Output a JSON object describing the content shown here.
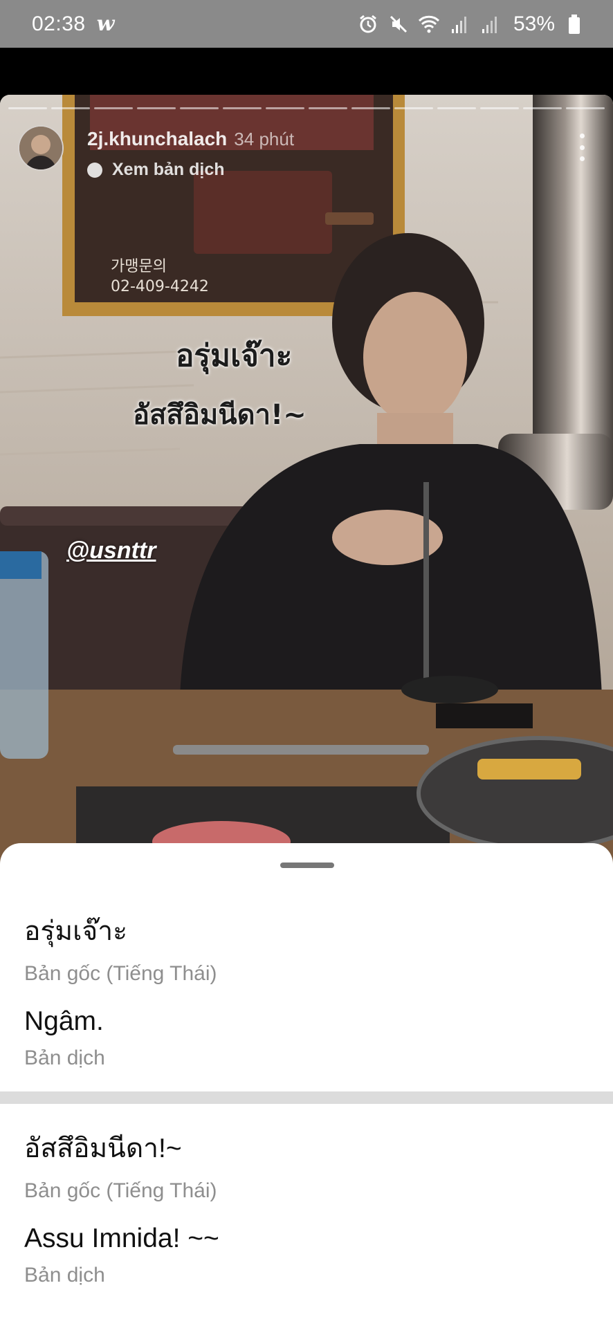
{
  "status_bar": {
    "time": "02:38",
    "app_glyph": "w",
    "icons": [
      "alarm-icon",
      "mute-icon",
      "wifi-icon",
      "signal-icon",
      "signal-icon-2"
    ],
    "battery_percent": "53%"
  },
  "story": {
    "username": "2j.khunchalach",
    "time_ago": "34 phút",
    "translate_link": "Xem bản dịch",
    "sticker_line_1": "อรุ่มเจ๊าะ",
    "sticker_line_2": "อัสสึอิมนีดา!~",
    "mention": "@usnttr",
    "poster_text_1": "가맹문의",
    "poster_text_2": "02-409-4242",
    "progress_segments": 14
  },
  "translation_sheet": {
    "entries": [
      {
        "text": "อรุ่มเจ๊าะ",
        "caption": "Bản gốc (Tiếng Thái)"
      },
      {
        "text": "Ngâm.",
        "caption": "Bản dịch"
      },
      {
        "text": "อัสสึอิมนีดา!~",
        "caption": "Bản gốc (Tiếng Thái)"
      },
      {
        "text": "Assu Imnida! ~~",
        "caption": "Bản dịch"
      }
    ]
  },
  "colors": {
    "status_bar_bg": "#8a8a8a",
    "sheet_bg": "#ffffff",
    "divider": "#dcdcdc",
    "caption_text": "#8e8e8e"
  }
}
